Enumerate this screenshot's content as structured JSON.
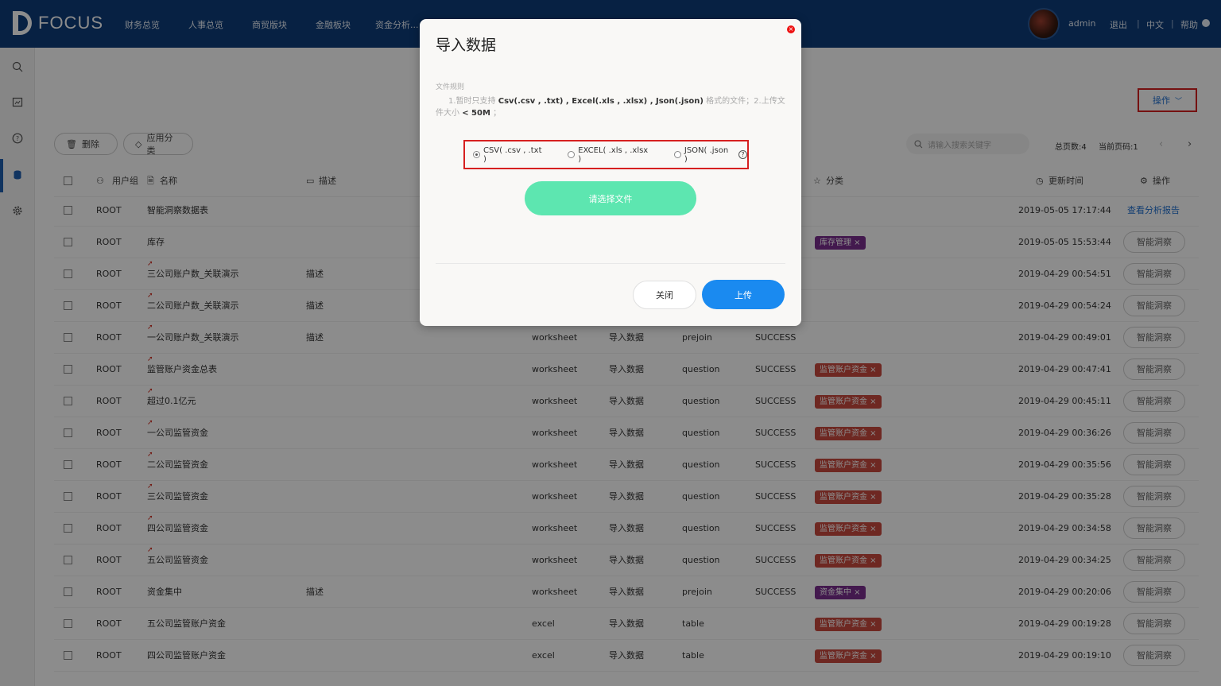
{
  "app": {
    "logo_text": "FOCUS",
    "nav": [
      "财务总览",
      "人事总览",
      "商贸版块",
      "金融板块",
      "资金分析..."
    ],
    "user": "admin",
    "logout": "退出",
    "language": "中文",
    "help": "帮助"
  },
  "sidebar": {
    "icons": [
      "search-icon",
      "bookmark-icon",
      "question-icon",
      "database-icon",
      "gear-icon"
    ],
    "active_index": 3
  },
  "toolbar": {
    "operate_label": "操作",
    "delete_label": "删除",
    "apply_category_label": "应用分类",
    "search_placeholder": "请输入搜索关键字",
    "total_pages": "总页数:4",
    "current_page": "当前页码:1"
  },
  "table": {
    "headers": {
      "user_group": "用户组",
      "name": "名称",
      "description": "描述",
      "category": "分类",
      "updated": "更新时间",
      "action": "操作"
    },
    "rows": [
      {
        "group": "ROOT",
        "name": "智能洞察数据表",
        "arrow": false,
        "desc": "",
        "type": "",
        "source": "",
        "kind": "",
        "status": "",
        "tag": "",
        "tag_color": "",
        "time": "2019-05-05 17:17:44",
        "action": "查看分析报告",
        "action_is_link": true
      },
      {
        "group": "ROOT",
        "name": "库存",
        "arrow": false,
        "desc": "",
        "type": "",
        "source": "",
        "kind": "",
        "status": "",
        "tag": "库存管理 ×",
        "tag_color": "purple",
        "time": "2019-05-05 15:53:44",
        "action": "智能洞察",
        "action_is_link": false
      },
      {
        "group": "ROOT",
        "name": "三公司账户数_关联演示",
        "arrow": true,
        "desc": "描述",
        "type": "",
        "source": "",
        "kind": "",
        "status": "",
        "tag": "",
        "tag_color": "",
        "time": "2019-04-29 00:54:51",
        "action": "智能洞察",
        "action_is_link": false
      },
      {
        "group": "ROOT",
        "name": "二公司账户数_关联演示",
        "arrow": true,
        "desc": "描述",
        "type": "",
        "source": "",
        "kind": "",
        "status": "",
        "tag": "",
        "tag_color": "",
        "time": "2019-04-29 00:54:24",
        "action": "智能洞察",
        "action_is_link": false
      },
      {
        "group": "ROOT",
        "name": "一公司账户数_关联演示",
        "arrow": true,
        "desc": "描述",
        "type": "worksheet",
        "source": "导入数据",
        "kind": "prejoin",
        "status": "SUCCESS",
        "tag": "",
        "tag_color": "",
        "time": "2019-04-29 00:49:01",
        "action": "智能洞察",
        "action_is_link": false
      },
      {
        "group": "ROOT",
        "name": "监管账户资金总表",
        "arrow": true,
        "desc": "",
        "type": "worksheet",
        "source": "导入数据",
        "kind": "question",
        "status": "SUCCESS",
        "tag": "监管账户资金 ×",
        "tag_color": "red",
        "time": "2019-04-29 00:47:41",
        "action": "智能洞察",
        "action_is_link": false
      },
      {
        "group": "ROOT",
        "name": "超过0.1亿元",
        "arrow": true,
        "desc": "",
        "type": "worksheet",
        "source": "导入数据",
        "kind": "question",
        "status": "SUCCESS",
        "tag": "监管账户资金 ×",
        "tag_color": "red",
        "time": "2019-04-29 00:45:11",
        "action": "智能洞察",
        "action_is_link": false
      },
      {
        "group": "ROOT",
        "name": "一公司监管资金",
        "arrow": true,
        "desc": "",
        "type": "worksheet",
        "source": "导入数据",
        "kind": "question",
        "status": "SUCCESS",
        "tag": "监管账户资金 ×",
        "tag_color": "red",
        "time": "2019-04-29 00:36:26",
        "action": "智能洞察",
        "action_is_link": false
      },
      {
        "group": "ROOT",
        "name": "二公司监管资金",
        "arrow": true,
        "desc": "",
        "type": "worksheet",
        "source": "导入数据",
        "kind": "question",
        "status": "SUCCESS",
        "tag": "监管账户资金 ×",
        "tag_color": "red",
        "time": "2019-04-29 00:35:56",
        "action": "智能洞察",
        "action_is_link": false
      },
      {
        "group": "ROOT",
        "name": "三公司监管资金",
        "arrow": true,
        "desc": "",
        "type": "worksheet",
        "source": "导入数据",
        "kind": "question",
        "status": "SUCCESS",
        "tag": "监管账户资金 ×",
        "tag_color": "red",
        "time": "2019-04-29 00:35:28",
        "action": "智能洞察",
        "action_is_link": false
      },
      {
        "group": "ROOT",
        "name": "四公司监管资金",
        "arrow": true,
        "desc": "",
        "type": "worksheet",
        "source": "导入数据",
        "kind": "question",
        "status": "SUCCESS",
        "tag": "监管账户资金 ×",
        "tag_color": "red",
        "time": "2019-04-29 00:34:58",
        "action": "智能洞察",
        "action_is_link": false
      },
      {
        "group": "ROOT",
        "name": "五公司监管资金",
        "arrow": true,
        "desc": "",
        "type": "worksheet",
        "source": "导入数据",
        "kind": "question",
        "status": "SUCCESS",
        "tag": "监管账户资金 ×",
        "tag_color": "red",
        "time": "2019-04-29 00:34:25",
        "action": "智能洞察",
        "action_is_link": false
      },
      {
        "group": "ROOT",
        "name": "资金集中",
        "arrow": false,
        "desc": "描述",
        "type": "worksheet",
        "source": "导入数据",
        "kind": "prejoin",
        "status": "SUCCESS",
        "tag": "资金集中 ×",
        "tag_color": "purple",
        "time": "2019-04-29 00:20:06",
        "action": "智能洞察",
        "action_is_link": false
      },
      {
        "group": "ROOT",
        "name": "五公司监管账户资金",
        "arrow": false,
        "desc": "",
        "type": "excel",
        "source": "导入数据",
        "kind": "table",
        "status": "",
        "tag": "监管账户资金 ×",
        "tag_color": "red",
        "time": "2019-04-29 00:19:28",
        "action": "智能洞察",
        "action_is_link": false
      },
      {
        "group": "ROOT",
        "name": "四公司监管账户资金",
        "arrow": false,
        "desc": "",
        "type": "excel",
        "source": "导入数据",
        "kind": "table",
        "status": "",
        "tag": "监管账户资金 ×",
        "tag_color": "red",
        "time": "2019-04-29 00:19:10",
        "action": "智能洞察",
        "action_is_link": false
      }
    ]
  },
  "modal": {
    "title": "导入数据",
    "rules_title": "文件规则",
    "rule_prefix": "1.暂时只支持",
    "rule_formats": "Csv(.csv , .txt) , Excel(.xls , .xlsx) , Json(.json)",
    "rule_mid": "格式的文件；2.上传文件大小",
    "rule_size": "< 50M",
    "rule_suffix": "；",
    "options": [
      {
        "label": "CSV( .csv , .txt )",
        "selected": true
      },
      {
        "label": "EXCEL( .xls , .xlsx )",
        "selected": false
      },
      {
        "label": "JSON( .json )",
        "selected": false
      }
    ],
    "choose_file": "请选择文件",
    "close": "关闭",
    "upload": "上传"
  }
}
